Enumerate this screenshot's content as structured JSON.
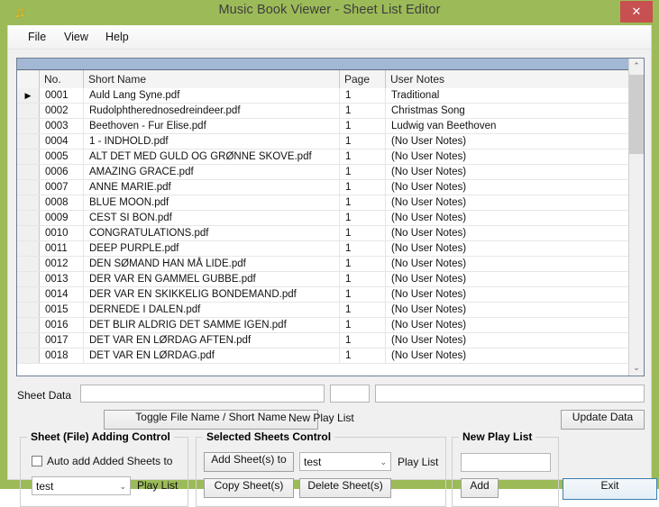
{
  "window": {
    "title": "Music Book Viewer - Sheet List Editor",
    "icon": "music-note-icon",
    "close_label": "✕",
    "titlebar_color": "#9cbb58",
    "close_color": "#c75050"
  },
  "menubar": {
    "items": [
      {
        "label": "File"
      },
      {
        "label": "View"
      },
      {
        "label": "Help"
      }
    ]
  },
  "grid": {
    "columns": [
      "",
      "No.",
      "Short Name",
      "Page",
      "User Notes"
    ],
    "selected_row_indicator": "▶",
    "rows": [
      {
        "sel": "▶",
        "no": "0001",
        "name": "Auld Lang Syne.pdf",
        "page": "1",
        "notes": "Traditional"
      },
      {
        "sel": "",
        "no": "0002",
        "name": "Rudolphtherednosedreindeer.pdf",
        "page": "1",
        "notes": "Christmas Song"
      },
      {
        "sel": "",
        "no": "0003",
        "name": "Beethoven - Fur Elise.pdf",
        "page": "1",
        "notes": "Ludwig van Beethoven"
      },
      {
        "sel": "",
        "no": "0004",
        "name": "1 - INDHOLD.pdf",
        "page": "1",
        "notes": "(No User Notes)"
      },
      {
        "sel": "",
        "no": "0005",
        "name": "ALT DET MED GULD OG GRØNNE SKOVE.pdf",
        "page": "1",
        "notes": "(No User Notes)"
      },
      {
        "sel": "",
        "no": "0006",
        "name": "AMAZING GRACE.pdf",
        "page": "1",
        "notes": "(No User Notes)"
      },
      {
        "sel": "",
        "no": "0007",
        "name": "ANNE MARIE.pdf",
        "page": "1",
        "notes": "(No User Notes)"
      },
      {
        "sel": "",
        "no": "0008",
        "name": "BLUE MOON.pdf",
        "page": "1",
        "notes": "(No User Notes)"
      },
      {
        "sel": "",
        "no": "0009",
        "name": "CEST SI BON.pdf",
        "page": "1",
        "notes": "(No User Notes)"
      },
      {
        "sel": "",
        "no": "0010",
        "name": "CONGRATULATIONS.pdf",
        "page": "1",
        "notes": "(No User Notes)"
      },
      {
        "sel": "",
        "no": "0011",
        "name": "DEEP PURPLE.pdf",
        "page": "1",
        "notes": "(No User Notes)"
      },
      {
        "sel": "",
        "no": "0012",
        "name": "DEN SØMAND HAN MÅ LIDE.pdf",
        "page": "1",
        "notes": "(No User Notes)"
      },
      {
        "sel": "",
        "no": "0013",
        "name": "DER VAR EN GAMMEL GUBBE.pdf",
        "page": "1",
        "notes": "(No User Notes)"
      },
      {
        "sel": "",
        "no": "0014",
        "name": "DER VAR EN SKIKKELIG BONDEMAND.pdf",
        "page": "1",
        "notes": "(No User Notes)"
      },
      {
        "sel": "",
        "no": "0015",
        "name": "DERNEDE I DALEN.pdf",
        "page": "1",
        "notes": "(No User Notes)"
      },
      {
        "sel": "",
        "no": "0016",
        "name": "DET BLIR ALDRIG DET SAMME IGEN.pdf",
        "page": "1",
        "notes": "(No User Notes)"
      },
      {
        "sel": "",
        "no": "0017",
        "name": "DET VAR EN LØRDAG AFTEN.pdf",
        "page": "1",
        "notes": "(No User Notes)"
      },
      {
        "sel": "",
        "no": "0018",
        "name": "DET VAR EN LØRDAG.pdf",
        "page": "1",
        "notes": "(No User Notes)"
      }
    ],
    "scrollbar": {
      "up_icon": "⌃",
      "down_icon": "⌄"
    }
  },
  "sheet_data": {
    "label": "Sheet Data",
    "field1_value": "",
    "field1_placeholder": "",
    "field2_value": "",
    "field2_placeholder": "",
    "field3_value": "",
    "field3_placeholder": "",
    "toggle_button": "Toggle File Name / Short Name",
    "new_play_list_label": "New Play List",
    "update_button": "Update Data"
  },
  "adding_control": {
    "title": "Sheet (File) Adding Control",
    "checkbox_label": "Auto add Added Sheets to",
    "checkbox_checked": false,
    "combo_value": "test",
    "combo_arrow": "⌄",
    "play_list_label": "Play List"
  },
  "selected_control": {
    "title": "Selected Sheets Control",
    "add_button": "Add Sheet(s) to",
    "copy_button": "Copy Sheet(s)",
    "delete_button": "Delete Sheet(s)",
    "combo_value": "test",
    "combo_arrow": "⌄",
    "play_list_label": "Play List"
  },
  "new_play_list": {
    "title": "New Play List",
    "input_value": "",
    "input_placeholder": "",
    "add_button": "Add"
  },
  "footer": {
    "exit_button": "Exit"
  }
}
